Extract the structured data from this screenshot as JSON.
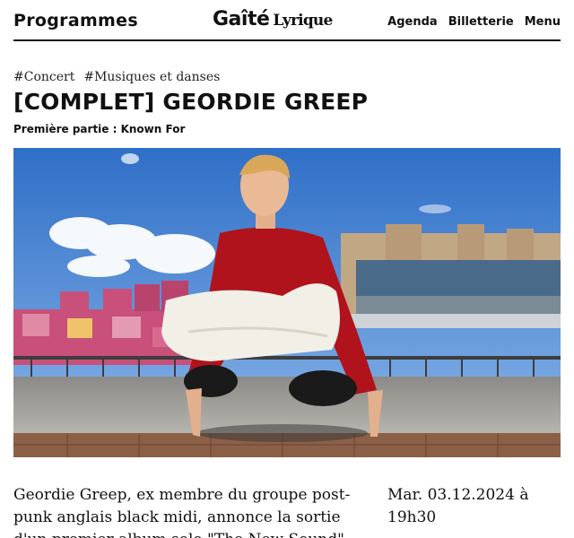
{
  "header": {
    "nav_left": "Programmes",
    "logo_main": "Gaîté",
    "logo_sub": "Lyrique",
    "nav_right": [
      "Agenda",
      "Billetterie",
      "Menu"
    ]
  },
  "event": {
    "tags": [
      "#Concert",
      "#Musiques et danses"
    ],
    "title": "[COMPLET] GEORDIE GREEP",
    "subtitle": "Première partie : Known For",
    "description": "Geordie Greep, ex membre du groupe post-punk anglais black midi, annonce la sortie d'un premier album solo \"The New Sound\"",
    "date": "Mar. 03.12.2024 à 19h30"
  },
  "colors": {
    "sky": "#4a86d6",
    "shirt": "#b0131c",
    "trousers": "#f1efe6",
    "buildings_pink": "#c8507a"
  }
}
